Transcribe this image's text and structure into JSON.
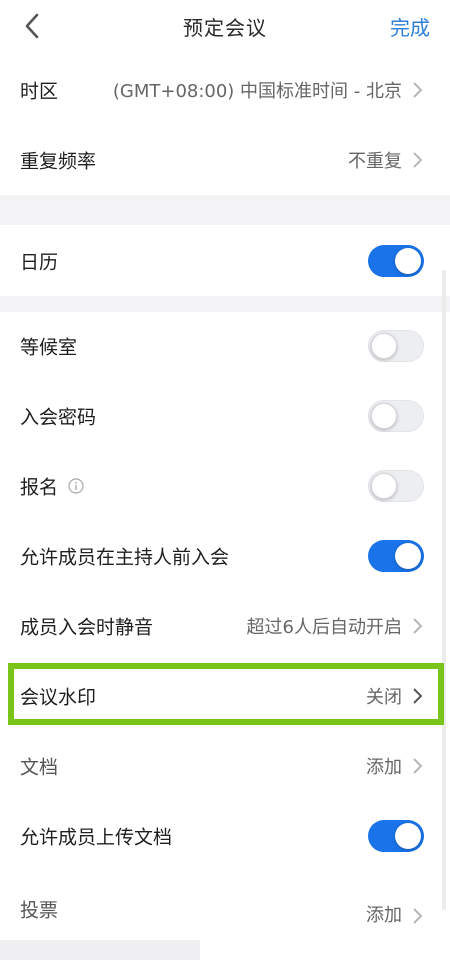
{
  "nav": {
    "title": "预定会议",
    "done_label": "完成"
  },
  "rows": {
    "timezone": {
      "label": "时区",
      "value": "(GMT+08:00) 中国标准时间 - 北京"
    },
    "repeat": {
      "label": "重复频率",
      "value": "不重复"
    },
    "calendar": {
      "label": "日历",
      "enabled": true
    },
    "waiting_room": {
      "label": "等候室",
      "enabled": false
    },
    "password": {
      "label": "入会密码",
      "enabled": false
    },
    "registration": {
      "label": "报名",
      "enabled": false
    },
    "join_before_host": {
      "label": "允许成员在主持人前入会",
      "enabled": true
    },
    "mute_on_join": {
      "label": "成员入会时静音",
      "value": "超过6人后自动开启"
    },
    "watermark": {
      "label": "会议水印",
      "value": "关闭"
    },
    "documents": {
      "label": "文档",
      "value": "添加"
    },
    "allow_upload": {
      "label": "允许成员上传文档",
      "enabled": true
    },
    "vote": {
      "label": "投票",
      "value": "添加"
    }
  },
  "colors": {
    "accent": "#1a73e8",
    "highlight": "#7ac41a",
    "link": "#2d7fd8"
  }
}
